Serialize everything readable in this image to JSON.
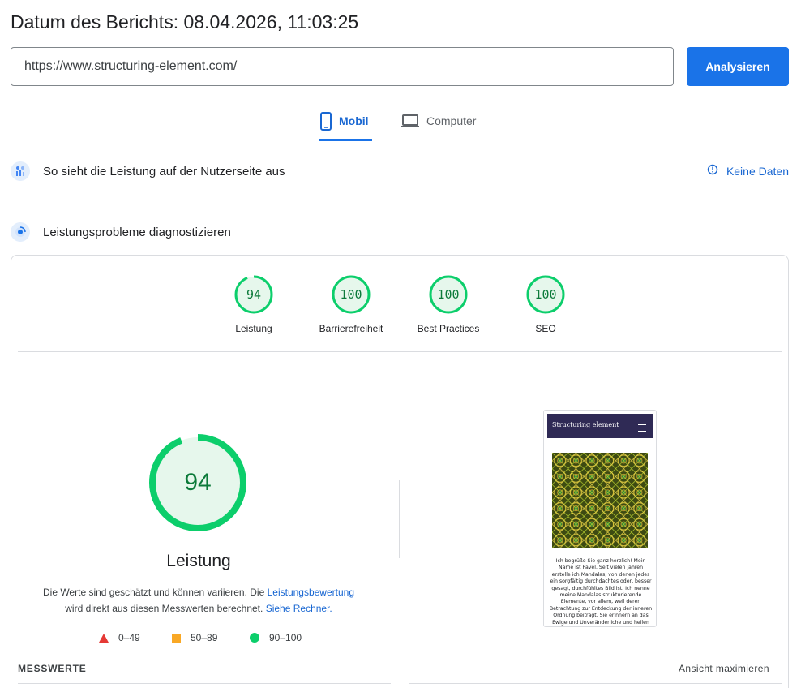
{
  "report": {
    "date_title": "Datum des Berichts: 08.04.2026, 11:03:25"
  },
  "search": {
    "url": "https://www.structuring-element.com/",
    "button_label": "Analysieren"
  },
  "tabs": [
    {
      "label": "Mobil",
      "icon": "smartphone-icon",
      "active": true
    },
    {
      "label": "Computer",
      "icon": "laptop-icon",
      "active": false
    }
  ],
  "field_data": {
    "title": "So sieht die Leistung auf der Nutzerseite aus",
    "no_data_label": "Keine Daten",
    "icon": "users-chart-icon"
  },
  "lab_data": {
    "title": "Leistungsprobleme diagnostizieren",
    "icon": "diagnostics-icon"
  },
  "categories": [
    {
      "score": "94",
      "label": "Leistung",
      "fraction": 0.94
    },
    {
      "score": "100",
      "label": "Barrierefreiheit",
      "fraction": 1.0
    },
    {
      "score": "100",
      "label": "Best Practices",
      "fraction": 1.0
    },
    {
      "score": "100",
      "label": "SEO",
      "fraction": 1.0
    }
  ],
  "performance": {
    "score": "94",
    "fraction": 0.94,
    "title": "Leistung",
    "note_part1": "Die Werte sind geschätzt und können variieren. Die",
    "note_link1": "Leistungsbewertung",
    "note_part2": "wird direkt aus diesen Messwerten berechnet.",
    "note_link2": "Siehe Rechner."
  },
  "legend": [
    {
      "shape": "triangle",
      "range": "0–49",
      "color": "#e53935"
    },
    {
      "shape": "square",
      "range": "50–89",
      "color": "#f9a825"
    },
    {
      "shape": "circle",
      "range": "90–100",
      "color": "#0cce6b"
    }
  ],
  "screenshot": {
    "site_name": "Structuring element",
    "text": "Ich begrüße Sie ganz herzlich! Mein Name ist Pavel. Seit vielen Jahren erstelle ich Mandalas, von denen jedes ein sorgfältig durchdachtes oder, besser gesagt, durchfühltes Bild ist. Ich nenne meine Mandalas strukturierende Elemente, vor allem, weil deren Betrachtung zur Entdeckung der inneren Ordnung beiträgt. Sie erinnern an das Ewige und Unveränderliche und heilen"
  },
  "metrics": {
    "heading": "MESSWERTE",
    "expand_label": "Ansicht maximieren"
  },
  "colors": {
    "accent": "#1a73e8",
    "pass": "#0cce6b",
    "pass_text": "#0c7a3a",
    "pass_fill": "#e6f7ec"
  }
}
